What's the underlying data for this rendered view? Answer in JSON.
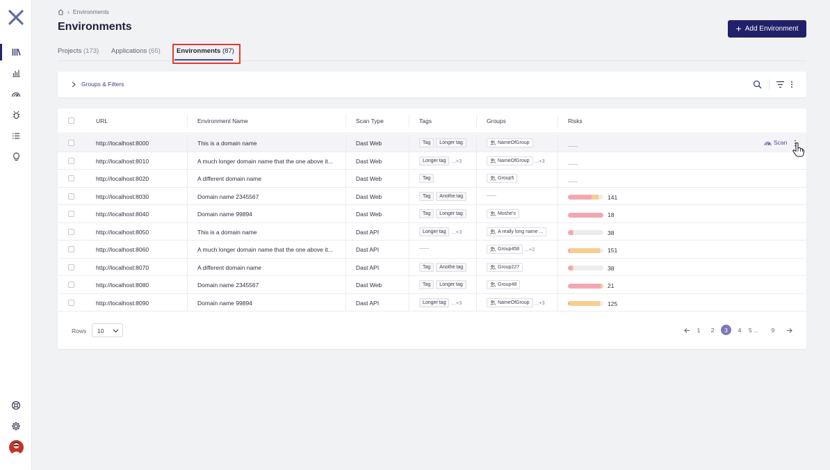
{
  "breadcrumb": {
    "current": "Environments"
  },
  "page": {
    "title": "Environments",
    "add_button": "Add Environment"
  },
  "tabs": [
    {
      "label": "Projects",
      "count": "(173)"
    },
    {
      "label": "Applications",
      "count": "(65)"
    },
    {
      "label": "Environments",
      "count": "(87)"
    }
  ],
  "filters": {
    "label": "Groups & Filters"
  },
  "table": {
    "columns": {
      "url": "URL",
      "name": "Environment Name",
      "scan_type": "Scan Type",
      "tags": "Tags",
      "groups": "Groups",
      "risks": "Risks"
    },
    "scan_label": "Scan",
    "rows": [
      {
        "url": "http://localhost:8000",
        "name": "This is a domain name",
        "scan_type": "Dast Web",
        "tags": [
          "Tag",
          "Longer tag"
        ],
        "tags_more": "",
        "group": "NameOfGroup",
        "groups_more": "",
        "risk_high": 0,
        "risk_med": 0,
        "risk_total": ""
      },
      {
        "url": "http://localhost:8010",
        "name": "A much longer domain name that the one above it...",
        "scan_type": "Dast Web",
        "tags": [
          "Longer tag"
        ],
        "tags_more": "...+3",
        "group": "NameOfGroup",
        "groups_more": "...+3",
        "risk_high": 0,
        "risk_med": 0,
        "risk_total": ""
      },
      {
        "url": "http://localhost:8020",
        "name": "A different domain name",
        "scan_type": "Dast Web",
        "tags": [
          "Tag"
        ],
        "tags_more": "",
        "group": "Group5",
        "groups_more": "",
        "risk_high": 0,
        "risk_med": 0,
        "risk_total": ""
      },
      {
        "url": "http://localhost:8030",
        "name": "Domain name 2345567",
        "scan_type": "Dast Web",
        "tags": [
          "Tag",
          "Anothe tag"
        ],
        "tags_more": "",
        "group": "",
        "groups_more": "",
        "risk_high": 0.66,
        "risk_med": 0.2,
        "risk_total": "141"
      },
      {
        "url": "http://localhost:8040",
        "name": "Domain name 99894",
        "scan_type": "Dast Web",
        "tags": [
          "Tag",
          "Longer tag"
        ],
        "tags_more": "",
        "group": "Moshe's",
        "groups_more": "",
        "risk_high": 1.0,
        "risk_med": 0,
        "risk_total": "18"
      },
      {
        "url": "http://localhost:8050",
        "name": "This is a domain name",
        "scan_type": "Dast API",
        "tags": [
          "Longer tag"
        ],
        "tags_more": "...+3",
        "group": "A really long name ...",
        "groups_more": "",
        "risk_high": 0.14,
        "risk_med": 0.02,
        "risk_total": "38"
      },
      {
        "url": "http://localhost:8060",
        "name": "A much longer domain name that the one above it...",
        "scan_type": "Dast API",
        "tags": [],
        "tags_more": "",
        "group": "Group458",
        "groups_more": "...+2",
        "risk_high": 0.06,
        "risk_med": 0.84,
        "risk_total": "151"
      },
      {
        "url": "http://localhost:8070",
        "name": "A different domain name",
        "scan_type": "Dast API",
        "tags": [
          "Tag",
          "Anothe tag"
        ],
        "tags_more": "",
        "group": "Group227",
        "groups_more": "",
        "risk_high": 0.12,
        "risk_med": 0.04,
        "risk_total": "38"
      },
      {
        "url": "http://localhost:8080",
        "name": "Domain name 2345567",
        "scan_type": "Dast Web",
        "tags": [
          "Tag",
          "Longer tag"
        ],
        "tags_more": "",
        "group": "Group48",
        "groups_more": "",
        "risk_high": 0.92,
        "risk_med": 0.06,
        "risk_total": "21"
      },
      {
        "url": "http://localhost:8090",
        "name": "Domain name 99894",
        "scan_type": "Dast API",
        "tags": [
          "Longer tag"
        ],
        "tags_more": "...+3",
        "group": "NameOfGroup",
        "groups_more": "...+3",
        "risk_high": 0.04,
        "risk_med": 0.86,
        "risk_total": "125"
      }
    ]
  },
  "footer": {
    "rows_label": "Rows",
    "rows_per_page": "10",
    "pages": [
      "1",
      "2",
      "3",
      "4",
      "5 ...",
      "9"
    ],
    "current_page": "3"
  },
  "colors": {
    "primary": "#22206a",
    "accent": "#4d4a9e",
    "risk_high": "#f3a7b2",
    "risk_medium": "#f8cd8e",
    "highlight": "#e53a2d"
  },
  "icons": {
    "sidebar_top": [
      "logo-x-icon",
      "library-icon",
      "bar-chart-icon",
      "radar-icon",
      "bug-icon",
      "list-icon",
      "lightbulb-icon"
    ],
    "sidebar_bottom": [
      "support-icon",
      "gear-icon",
      "avatar"
    ]
  }
}
